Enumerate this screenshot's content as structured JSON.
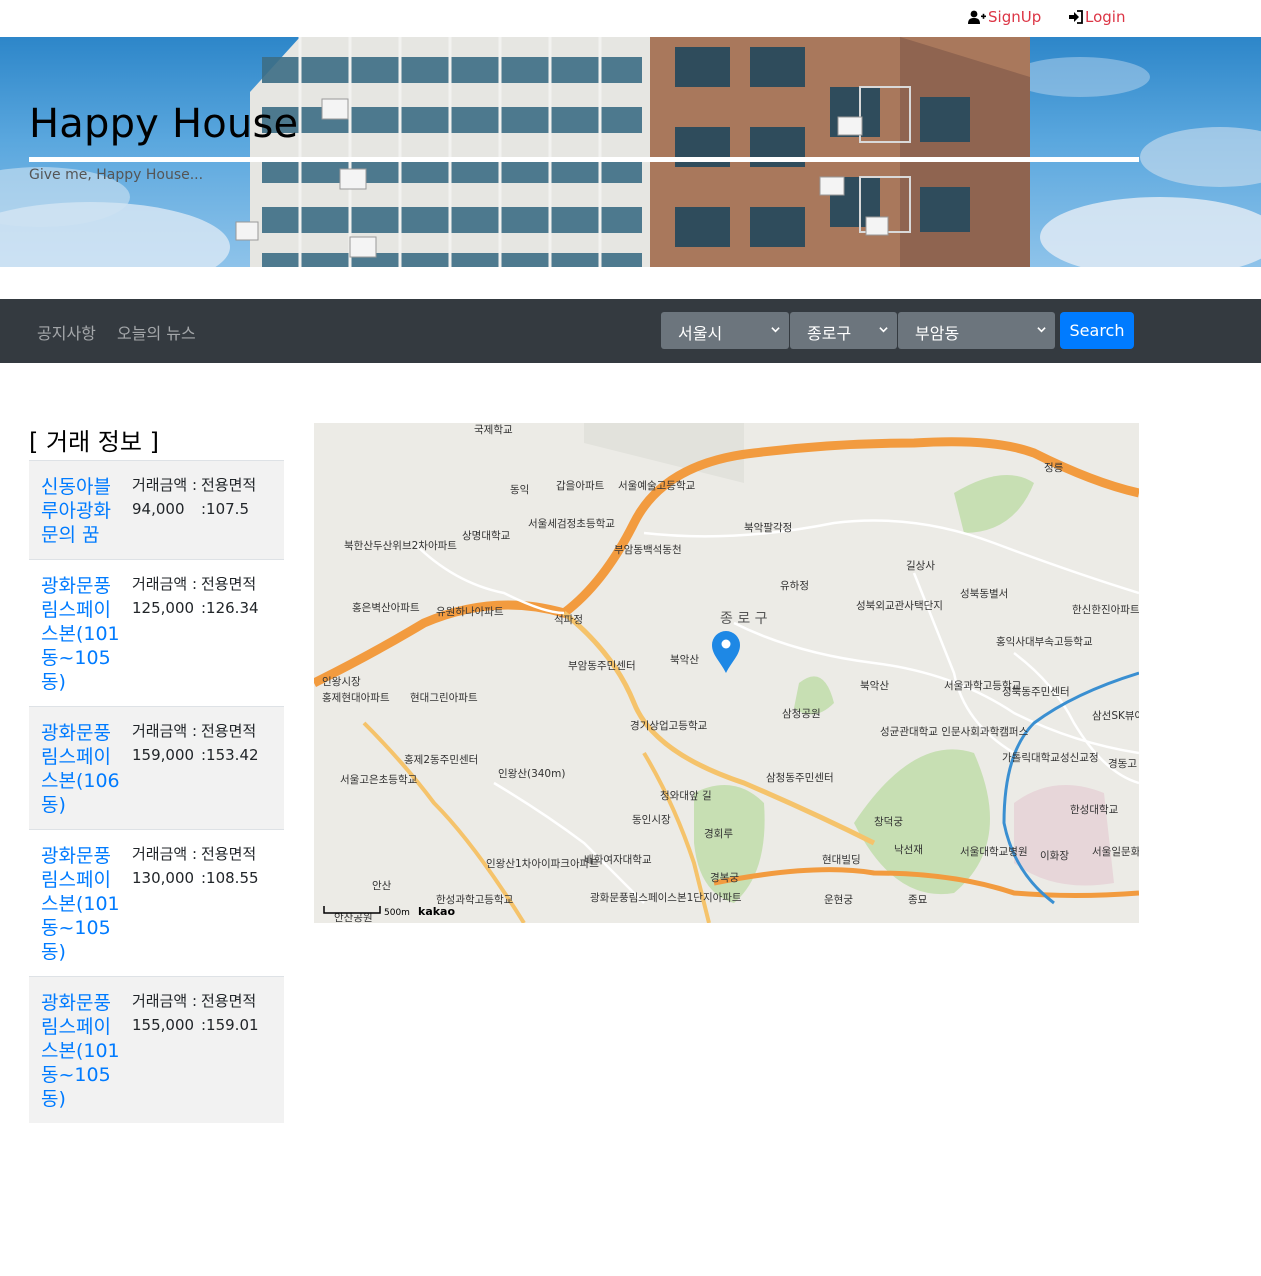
{
  "auth": {
    "signup_label": "SignUp",
    "login_label": "Login"
  },
  "hero": {
    "title": "Happy House",
    "subtitle": "Give me, Happy House..."
  },
  "nav": {
    "notice_label": "공지사항",
    "news_label": "오늘의 뉴스",
    "city_selected": "서울시",
    "gu_selected": "종로구",
    "dong_selected": "부암동",
    "search_label": "Search"
  },
  "deals": {
    "heading": "[ 거래 정보 ]",
    "price_label": "거래금액 :",
    "area_label": "전용면적",
    "rows": [
      {
        "name": "신동아블루아광화문의 꿈",
        "price": "94,000",
        "area": ":107.5"
      },
      {
        "name": "광화문풍림스페이스본(101동~105동)",
        "price": "125,000",
        "area": ":126.34"
      },
      {
        "name": "광화문풍림스페이스본(106동)",
        "price": "159,000",
        "area": ":153.42"
      },
      {
        "name": "광화문풍림스페이스본(101동~105동)",
        "price": "130,000",
        "area": ":108.55"
      },
      {
        "name": "광화문풍림스페이스본(101동~105동)",
        "price": "155,000",
        "area": ":159.01"
      }
    ]
  },
  "map": {
    "district_label": "종 로 구",
    "scale_label": "500m",
    "brand": "kakao",
    "labels": [
      "국제학교",
      "동익",
      "갑을아파트",
      "서울예술고등학교",
      "상명대학교",
      "서울세검정초등학교",
      "부암동백석동천",
      "북악팔각정",
      "북한산두산위브2차아파트",
      "홍은벽산아파트",
      "유원하나아파트",
      "석파정",
      "북악산",
      "유하정",
      "길상사",
      "성북동별서",
      "성북외교관사택단지",
      "한신한진아파트",
      "홍익사대부속고등학교",
      "부암동주민센터",
      "인왕시장",
      "홍제현대아파트",
      "현대그린아파트",
      "경기상업고등학교",
      "삼청공원",
      "북악산",
      "서울과학고등학교",
      "성북동주민센터",
      "삼선SK뷰아파트",
      "홍제2동주민센터",
      "서울고은초등학교",
      "인왕산(340m)",
      "삼청동주민센터",
      "청와대앞 길",
      "성균관대학교 인문사회과학캠퍼스",
      "가톨릭대학교성신교정",
      "경동고",
      "동인시장",
      "경회루",
      "창덕궁",
      "낙선재",
      "서울대학교병원",
      "이화장",
      "한성대학교",
      "서울일문화고등학교",
      "인왕산1차아이파크아파트",
      "배화여자대학교",
      "경복궁",
      "현대빌딩",
      "안산",
      "한성과학고등학교",
      "광화문풍림스페이스본1단지아파트",
      "운현궁",
      "종묘",
      "안산공원",
      "정릉"
    ]
  }
}
